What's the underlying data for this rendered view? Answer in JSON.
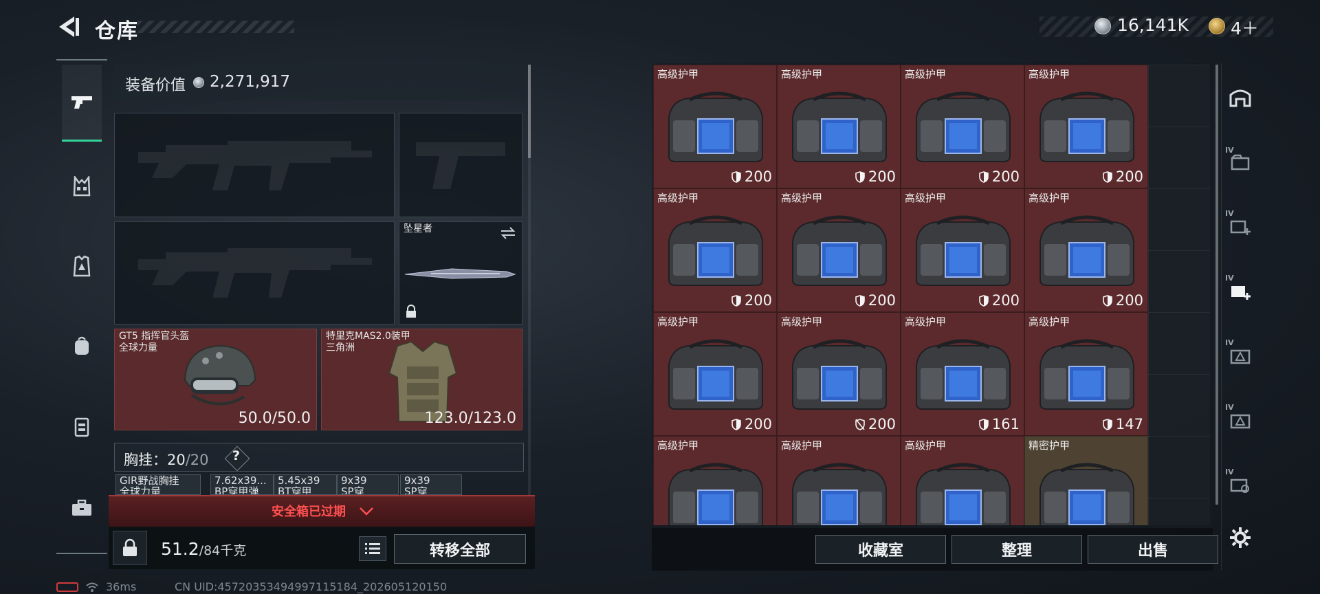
{
  "header": {
    "title": "仓库",
    "currency_amount": "16,141K",
    "medal_amount": "4＋"
  },
  "categories": [
    {
      "name": "weapon",
      "icon": "pistol-icon",
      "active": true
    },
    {
      "name": "vest",
      "icon": "vest-icon",
      "active": false
    },
    {
      "name": "armor",
      "icon": "armor-plate-icon",
      "active": false
    },
    {
      "name": "backpack",
      "icon": "backpack-icon",
      "active": false
    },
    {
      "name": "chest-rig",
      "icon": "chest-rig-icon",
      "active": false
    },
    {
      "name": "case",
      "icon": "briefcase-icon",
      "active": false
    }
  ],
  "equipment": {
    "value_label": "装备价值",
    "value": "2,271,917",
    "melee_name": "坠星者",
    "helmet": {
      "name": "GT5 指挥官头盔",
      "brand": "全球力量",
      "durability": "50.0/50.0"
    },
    "armor": {
      "name": "特里克MAS2.0装甲",
      "brand": "三角洲",
      "durability": "123.0/123.0"
    },
    "chest_rig_label": "胸挂：",
    "chest_rig_current": "20",
    "chest_rig_max": "/20",
    "chest_rig_help": "?",
    "mini_slots": [
      {
        "line1": "GIR野战胸挂",
        "line2": "全球力量"
      },
      {
        "line1": "7.62x39...",
        "line2": "BP穿甲弹"
      },
      {
        "line1": "5.45x39",
        "line2": "BT穿甲"
      },
      {
        "line1": "9x39",
        "line2": "SP穿"
      },
      {
        "line1": "9x39",
        "line2": "SP穿"
      }
    ],
    "safe_box_status": "安全箱已过期",
    "weight_current": "51.2",
    "weight_max": "/84千克",
    "transfer_all": "转移全部"
  },
  "grid_items": [
    {
      "name": "高级护甲",
      "durability": "200",
      "broken": false,
      "gold": false
    },
    {
      "name": "高级护甲",
      "durability": "200",
      "broken": false,
      "gold": false
    },
    {
      "name": "高级护甲",
      "durability": "200",
      "broken": false,
      "gold": false
    },
    {
      "name": "高级护甲",
      "durability": "200",
      "broken": false,
      "gold": false
    },
    {
      "name": "高级护甲",
      "durability": "200",
      "broken": false,
      "gold": false
    },
    {
      "name": "高级护甲",
      "durability": "200",
      "broken": false,
      "gold": false
    },
    {
      "name": "高级护甲",
      "durability": "200",
      "broken": false,
      "gold": false
    },
    {
      "name": "高级护甲",
      "durability": "200",
      "broken": false,
      "gold": false
    },
    {
      "name": "高级护甲",
      "durability": "200",
      "broken": false,
      "gold": false
    },
    {
      "name": "高级护甲",
      "durability": "200",
      "broken": true,
      "gold": false
    },
    {
      "name": "高级护甲",
      "durability": "161",
      "broken": false,
      "gold": false
    },
    {
      "name": "高级护甲",
      "durability": "147",
      "broken": false,
      "gold": false
    },
    {
      "name": "高级护甲",
      "durability": "",
      "broken": false,
      "gold": false
    },
    {
      "name": "高级护甲",
      "durability": "",
      "broken": false,
      "gold": false
    },
    {
      "name": "高级护甲",
      "durability": "",
      "broken": false,
      "gold": false
    },
    {
      "name": "精密护甲",
      "durability": "",
      "broken": false,
      "gold": true
    }
  ],
  "grid_actions": {
    "collection": "收藏室",
    "organize": "整理",
    "sell": "出售"
  },
  "side_tabs": [
    {
      "icon": "home-storage-icon",
      "tag": ""
    },
    {
      "icon": "storage-folder-icon",
      "tag": "IV"
    },
    {
      "icon": "add-storage-icon",
      "tag": "IV"
    },
    {
      "icon": "add-storage-active-icon",
      "tag": "IV"
    },
    {
      "icon": "storage-alert-icon",
      "tag": "IV"
    },
    {
      "icon": "storage-warning-icon",
      "tag": "IV"
    },
    {
      "icon": "storage-search-icon",
      "tag": "IV"
    },
    {
      "icon": "settings-gear-icon",
      "tag": ""
    }
  ],
  "status": {
    "ping": "36ms",
    "uid": "CN UID:45720353494997115184_202605120150"
  },
  "colors": {
    "accent_green": "#34d39a",
    "item_red": "#5c2a2c",
    "warning_red": "#ff5050"
  }
}
